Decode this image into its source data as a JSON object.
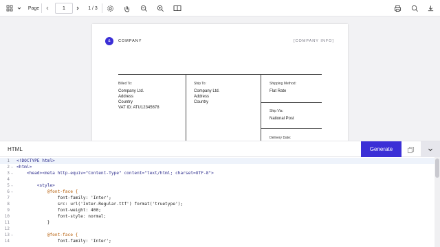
{
  "toolbar": {
    "page_label": "Page",
    "page_value": "1",
    "page_count": "1 / 3"
  },
  "document": {
    "logo_letter": "&",
    "company": "COMPANY",
    "company_info": "[COMPANY INFO]",
    "billed_to_label": "Billed To:",
    "billed_to_lines": [
      "Company Ltd.",
      "Address",
      "Country",
      "VAT ID: ATU12345678"
    ],
    "ship_to_label": "Ship To:",
    "ship_to_lines": [
      "Company Ltd.",
      "Address",
      "Country"
    ],
    "shipping_method_label": "Shipping Method:",
    "shipping_method_value": "Flat Rate",
    "ship_via_label": "Ship Via:",
    "ship_via_value": "National Post",
    "delivery_date_label": "Delivery Date:"
  },
  "editor": {
    "title": "HTML",
    "generate_label": "Generate"
  },
  "code_lines": [
    {
      "n": "1",
      "fold": "",
      "text": "<!DOCTYPE html>"
    },
    {
      "n": "2",
      "fold": "⌄",
      "text": "<html>"
    },
    {
      "n": "3",
      "fold": "⌄",
      "text": "    <head><meta http-equiv=\"Content-Type\" content=\"text/html; charset=UTF-8\">"
    },
    {
      "n": "4",
      "fold": "",
      "text": ""
    },
    {
      "n": "5",
      "fold": "⌄",
      "text": "        <style>"
    },
    {
      "n": "6",
      "fold": "⌄",
      "text": "            @font-face {"
    },
    {
      "n": "7",
      "fold": "",
      "text": "                font-family: 'Inter';"
    },
    {
      "n": "8",
      "fold": "",
      "text": "                src: url('Inter-Regular.ttf') format('truetype');"
    },
    {
      "n": "9",
      "fold": "",
      "text": "                font-weight: 400;"
    },
    {
      "n": "10",
      "fold": "",
      "text": "                font-style: normal;"
    },
    {
      "n": "11",
      "fold": "",
      "text": "            }"
    },
    {
      "n": "12",
      "fold": "",
      "text": ""
    },
    {
      "n": "13",
      "fold": "⌄",
      "text": "            @font-face {"
    },
    {
      "n": "14",
      "fold": "",
      "text": "                font-family: 'Inter';"
    }
  ],
  "colors": {
    "accent": "#3b2fd6",
    "active_line": "#eef3fb"
  }
}
